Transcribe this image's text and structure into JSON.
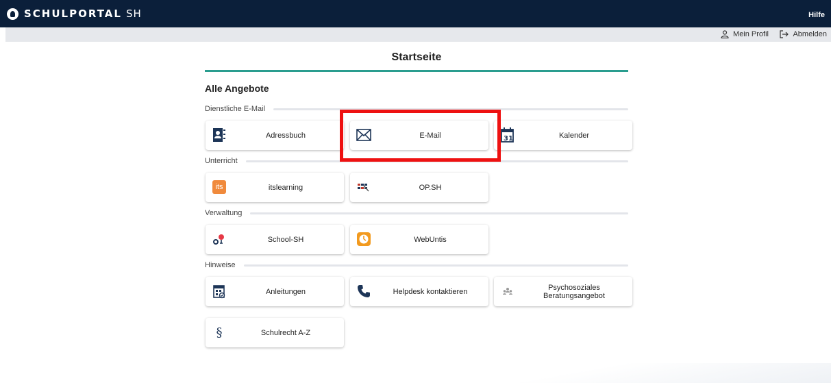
{
  "app": {
    "brand": "SCHULPORTAL",
    "brand_suffix": "SH",
    "help": "Hilfe"
  },
  "user_menu": {
    "profile": "Mein Profil",
    "logout": "Abmelden"
  },
  "page": {
    "title": "Startseite",
    "section": "Alle Angebote"
  },
  "categories": [
    {
      "label": "Dienstliche E-Mail",
      "tiles": [
        {
          "label": "Adressbuch",
          "icon": "address-book-icon"
        },
        {
          "label": "E-Mail",
          "icon": "envelope-icon"
        },
        {
          "label": "Kalender",
          "icon": "calendar-icon"
        }
      ]
    },
    {
      "label": "Unterricht",
      "tiles": [
        {
          "label": "itslearning",
          "icon": "itslearning-icon",
          "icon_text": "its"
        },
        {
          "label": "OP.SH",
          "icon": "opsh-icon"
        }
      ]
    },
    {
      "label": "Verwaltung",
      "tiles": [
        {
          "label": "School-SH",
          "icon": "school-sh-icon"
        },
        {
          "label": "WebUntis",
          "icon": "webuntis-icon"
        }
      ]
    },
    {
      "label": "Hinweise",
      "tiles": [
        {
          "label": "Anleitungen",
          "icon": "manual-icon"
        },
        {
          "label": "Helpdesk kontaktieren",
          "icon": "phone-icon"
        },
        {
          "label": "Psychosoziales Beratungsangebot",
          "icon": "people-icon"
        },
        {
          "label": "Schulrecht A-Z",
          "icon": "paragraph-icon",
          "icon_text": "§"
        }
      ]
    }
  ],
  "colors": {
    "topbar": "#0b1f3a",
    "accent": "#2a9d8f",
    "highlight": "#ee1111",
    "its_orange": "#f08a3c",
    "webuntis_orange": "#f29a1f"
  }
}
